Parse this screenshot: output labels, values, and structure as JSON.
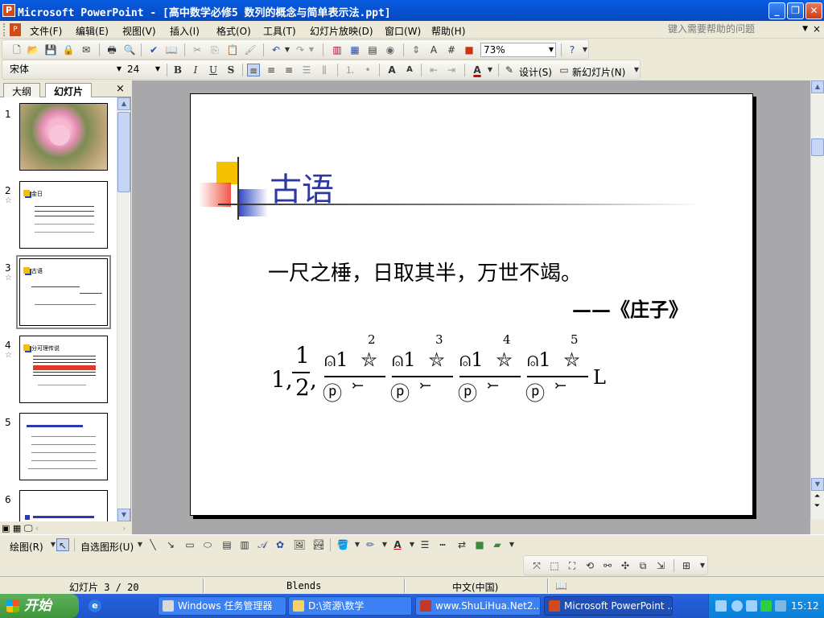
{
  "window": {
    "title": "Microsoft PowerPoint - [高中数学必修5 数列的概念与简单表示法.ppt]",
    "minimize": "_",
    "maximize": "❐",
    "close": "✕"
  },
  "menubar": {
    "items": [
      "文件(F)",
      "编辑(E)",
      "视图(V)",
      "插入(I)",
      "格式(O)",
      "工具(T)",
      "幻灯片放映(D)",
      "窗口(W)",
      "帮助(H)"
    ],
    "help_placeholder": "键入需要帮助的问题",
    "doc_close": "×"
  },
  "toolbar_standard": {
    "zoom": "73%"
  },
  "toolbar_formatting": {
    "font": "宋体",
    "size": "24",
    "bold": "B",
    "italic": "I",
    "underline": "U",
    "shadow": "S",
    "design": "设计(S)",
    "new_slide": "新幻灯片(N)"
  },
  "left_panel": {
    "tab_outline": "大纲",
    "tab_slides": "幻灯片",
    "close": "×",
    "thumbnails": [
      {
        "num": "1",
        "star": false,
        "title": ""
      },
      {
        "num": "2",
        "star": true,
        "title": "金日"
      },
      {
        "num": "3",
        "star": true,
        "title": "古语",
        "selected": true
      },
      {
        "num": "4",
        "star": true,
        "title": "分可理传说"
      },
      {
        "num": "5",
        "star": false,
        "title": ""
      },
      {
        "num": "6",
        "star": false,
        "title": ""
      }
    ]
  },
  "slide": {
    "title": "古语",
    "quote": "一尺之棰，日取其半，万世不竭。",
    "attribution": "——《庄子》",
    "formula": {
      "lead": "1,",
      "num": "1",
      "den": "2",
      "comma": ",",
      "exponents": [
        "2",
        "3",
        "4",
        "5"
      ],
      "tail": "L"
    }
  },
  "drawing_toolbar": {
    "draw": "绘图(R)",
    "autoshapes": "自选图形(U)"
  },
  "statusbar": {
    "slide_pos": "幻灯片 3 / 20",
    "design": "Blends",
    "language": "中文(中国)"
  },
  "taskbar": {
    "start": "开始",
    "tasks": [
      "Windows 任务管理器",
      "D:\\资源\\数学",
      "www.ShuLiHua.Net2...",
      "Microsoft PowerPoint ..."
    ],
    "clock": "15:12"
  }
}
